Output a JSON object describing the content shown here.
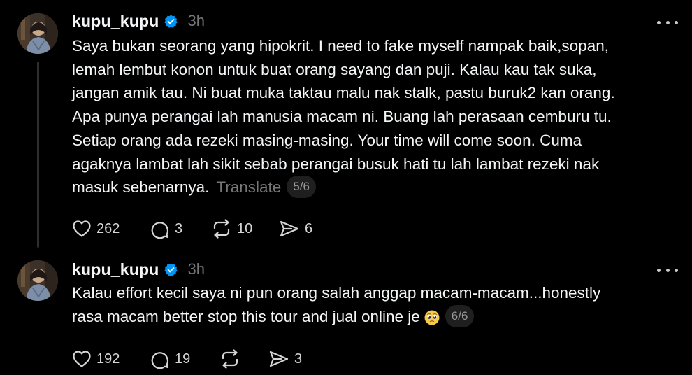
{
  "colors": {
    "background": "#000000",
    "text": "#f3f5f7",
    "muted": "#777777",
    "verified": "#0095f6",
    "thread_line": "#2e2e2e"
  },
  "posts": [
    {
      "username": "kupu_kupu",
      "verified": true,
      "time": "3h",
      "body_lines": [
        "Saya bukan seorang yang hipokrit. I need to fake myself nampak baik,sopan,",
        "lemah lembut konon untuk buat orang sayang dan puji. Kalau kau tak suka,",
        "jangan amik tau. Ni buat muka taktau malu nak stalk, pastu buruk2 kan orang.",
        "Apa punya perangai lah manusia macam ni. Buang lah perasaan cemburu tu.",
        "Setiap orang ada rezeki masing-masing. Your time will come soon. Cuma",
        "agaknya lambat lah sikit sebab perangai busuk hati tu lah lambat rezeki nak",
        "masuk sebenarnya."
      ],
      "translate_label": "Translate",
      "page_indicator": "5/6",
      "likes": "262",
      "replies": "3",
      "reposts": "10",
      "shares": "6"
    },
    {
      "username": "kupu_kupu",
      "verified": true,
      "time": "3h",
      "body_lines": [
        "Kalau effort kecil saya ni pun orang salah anggap macam-macam...honestly",
        "rasa macam better stop this tour and jual online je"
      ],
      "emoji": "pleading-face-emoji",
      "page_indicator": "6/6",
      "likes": "192",
      "replies": "19",
      "shares": "3"
    }
  ],
  "icons": {
    "more": "more-dots-icon",
    "like": "heart-icon",
    "reply": "comment-icon",
    "repost": "repost-icon",
    "share": "send-icon",
    "verified": "verified-badge-icon"
  }
}
